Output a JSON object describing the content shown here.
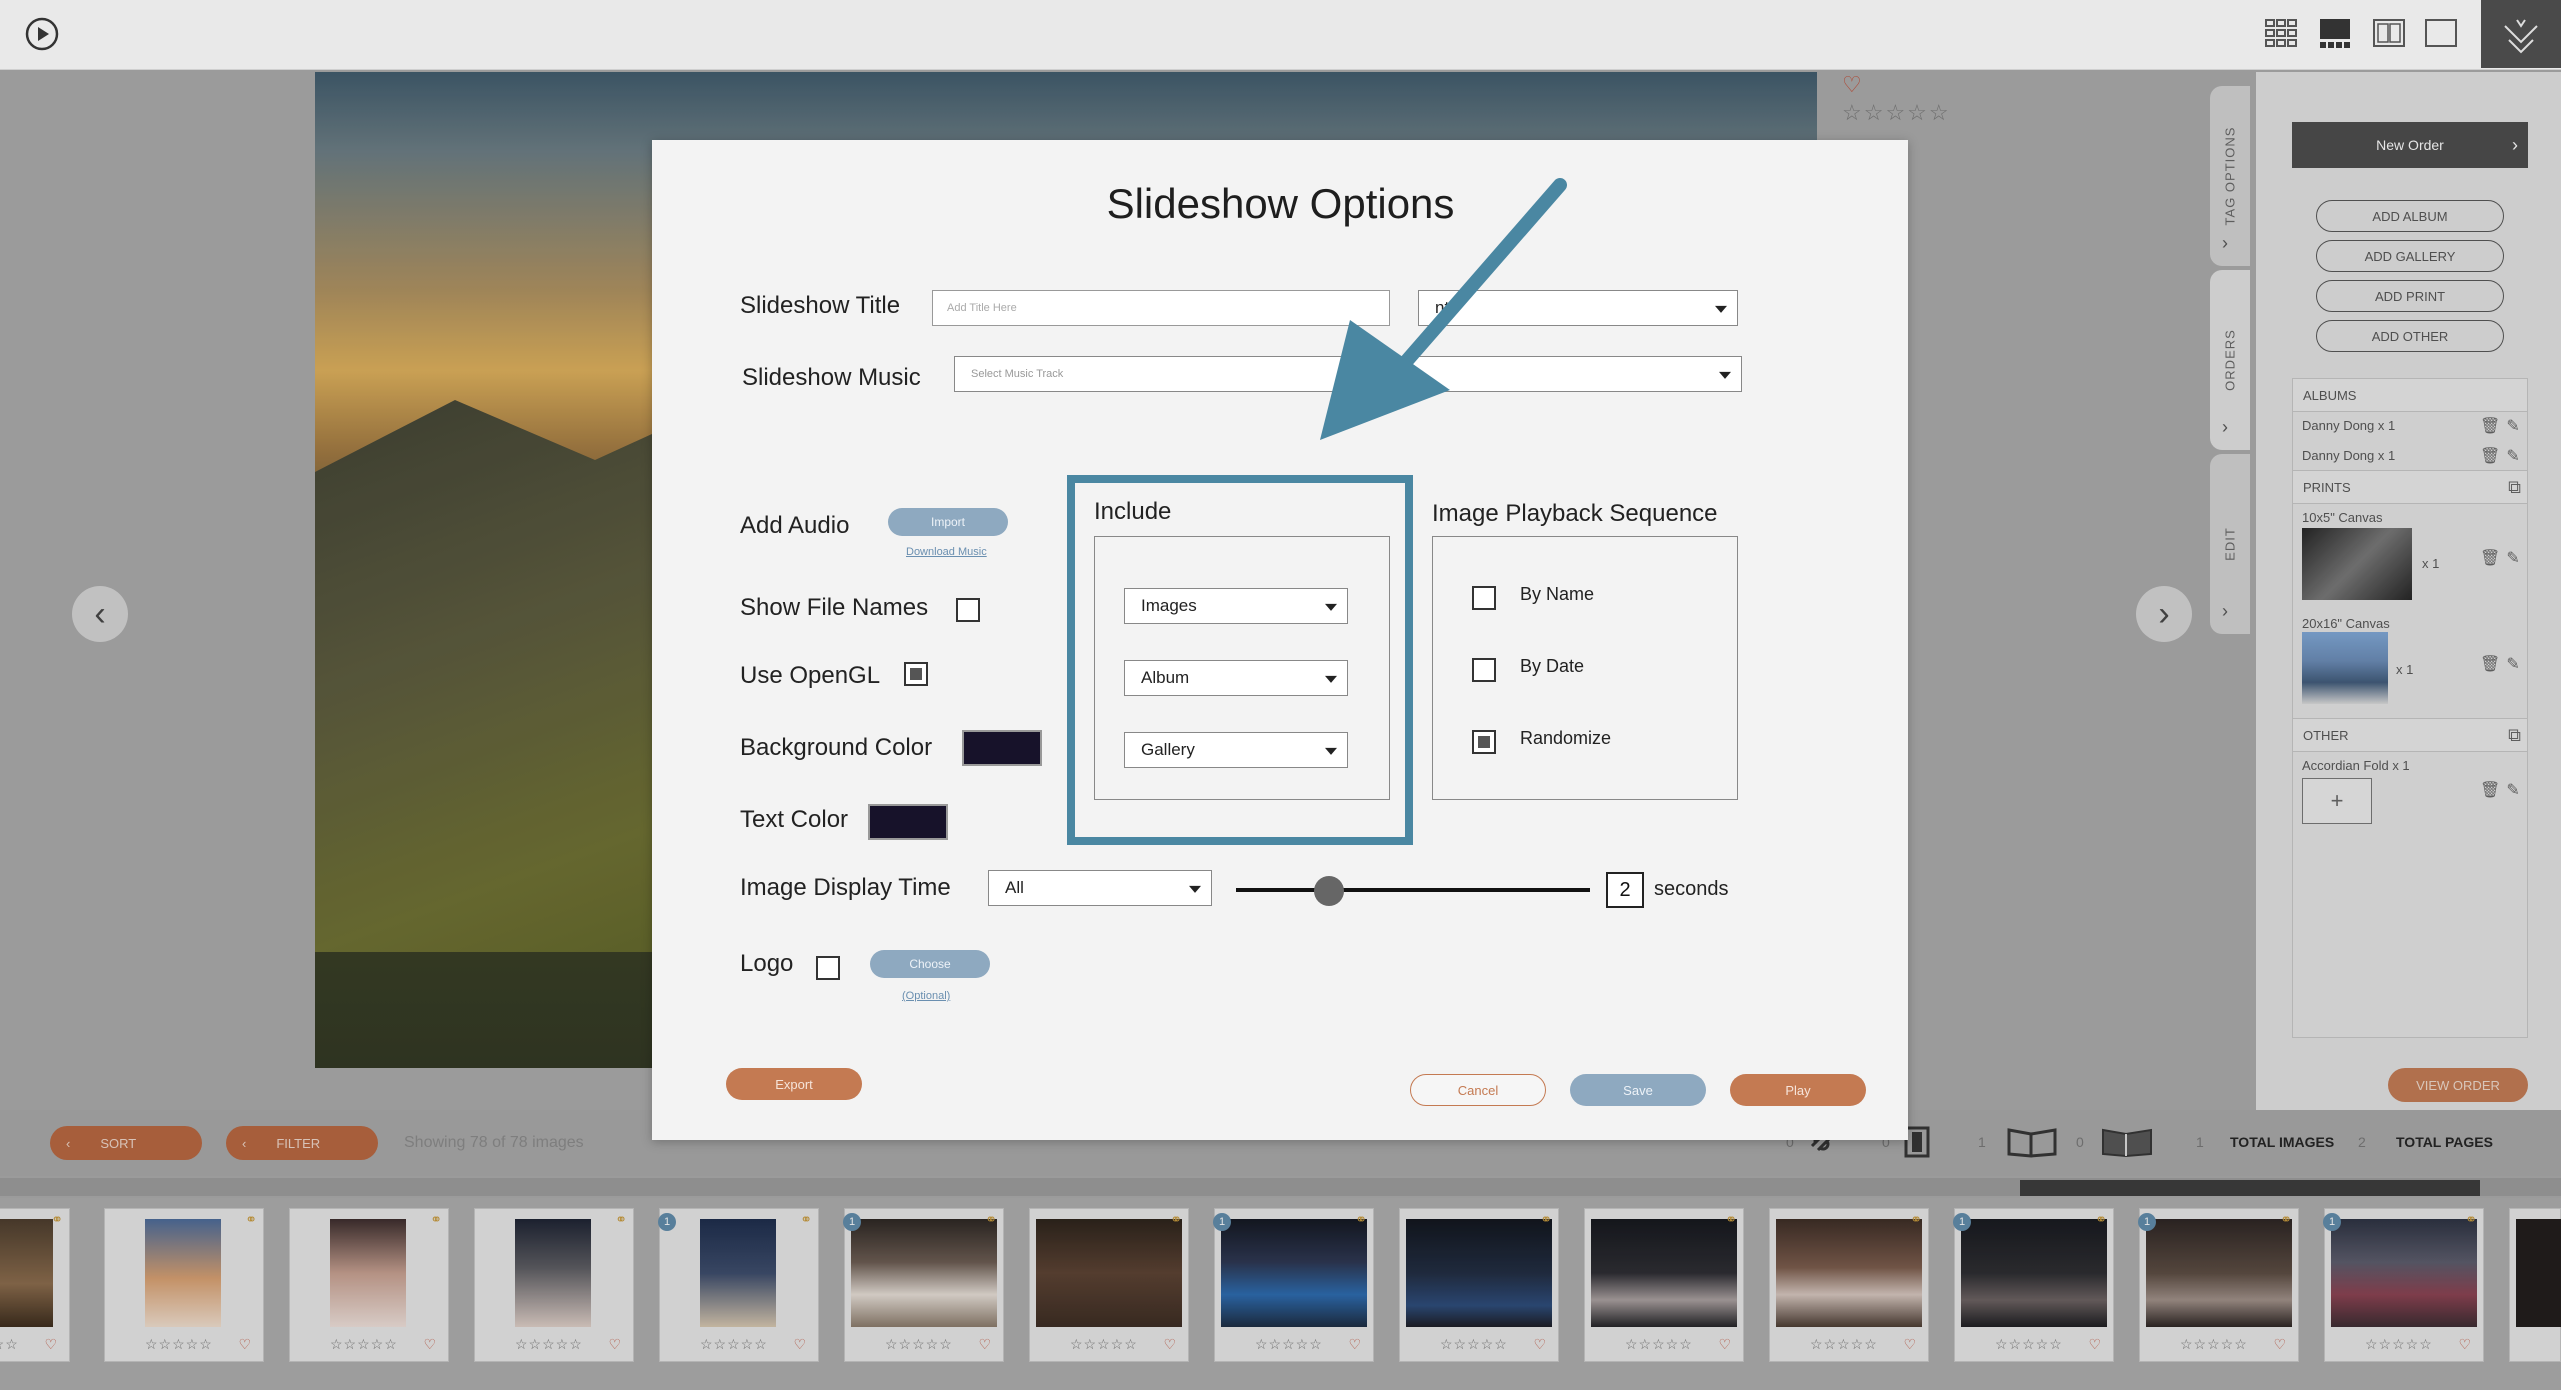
{
  "topbar": {
    "icons": [
      "play-circle-icon",
      "grid-view-icon",
      "filmstrip-view-icon",
      "compare-view-icon",
      "single-view-icon",
      "logo-icon"
    ]
  },
  "photo": {
    "nav_prev": "‹",
    "nav_next": "›",
    "heart": "♡",
    "stars": "☆☆☆☆☆"
  },
  "right_panel": {
    "tabs": [
      "TAG OPTIONS",
      "ORDERS",
      "EDIT"
    ],
    "new_order": "New Order",
    "add_buttons": [
      "ADD ALBUM",
      "ADD GALLERY",
      "ADD PRINT",
      "ADD OTHER"
    ],
    "albums_header": "ALBUMS",
    "albums": [
      "Danny Dong x 1",
      "Danny Dong x 1"
    ],
    "prints_header": "PRINTS",
    "prints": [
      {
        "name": "10x5\" Canvas",
        "qty": "x 1"
      },
      {
        "name": "20x16\" Canvas",
        "qty": "x 1"
      }
    ],
    "other_header": "OTHER",
    "other": [
      "Accordian Fold x 1"
    ],
    "add_symbol": "+",
    "view_order": "VIEW ORDER"
  },
  "bottombar": {
    "sort": "SORT",
    "filter": "FILTER",
    "showing": "Showing 78 of 78 images",
    "counts": [
      "0",
      "0",
      "1",
      "0",
      "1",
      "2"
    ],
    "total_images": "TOTAL IMAGES",
    "total_pages": "TOTAL PAGES"
  },
  "filmstrip": {
    "stars": "☆☆☆☆☆",
    "heart": "♡",
    "badge": "1"
  },
  "modal": {
    "title": "Slideshow Options",
    "slideshow_title_label": "Slideshow Title",
    "slideshow_title_placeholder": "Add Title Here",
    "font_select": "nt",
    "slideshow_music_label": "Slideshow Music",
    "music_select": "Select Music Track",
    "add_audio_label": "Add Audio",
    "import_button": "Import",
    "download_music": "Download Music",
    "show_file_names_label": "Show File Names",
    "use_opengl_label": "Use OpenGL",
    "background_color_label": "Background Color",
    "text_color_label": "Text Color",
    "image_display_time_label": "Image Display Time",
    "display_time_select": "All",
    "seconds_value": "2",
    "seconds_label": "seconds",
    "logo_label": "Logo",
    "choose_button": "Choose",
    "optional_link": "(Optional)",
    "include_label": "Include",
    "include_options": [
      "Images",
      "Album",
      "Gallery"
    ],
    "playback_label": "Image Playback Sequence",
    "playback_options": [
      {
        "label": "By Name",
        "checked": false
      },
      {
        "label": "By Date",
        "checked": false
      },
      {
        "label": "Randomize",
        "checked": true
      }
    ],
    "export_button": "Export",
    "cancel_button": "Cancel",
    "save_button": "Save",
    "play_button": "Play",
    "colors": {
      "background": "#17122a",
      "text": "#17122a",
      "accent": "#4a87a2",
      "orange": "#c47a52",
      "blue": "#8ea9c0"
    }
  }
}
